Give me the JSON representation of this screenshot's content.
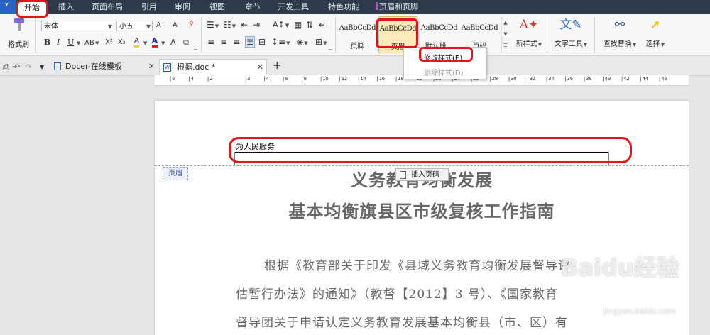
{
  "menubar": {
    "app_menu_arrow": "▾",
    "tabs": [
      {
        "label": "开始",
        "active": true
      },
      {
        "label": "插入"
      },
      {
        "label": "页面布局"
      },
      {
        "label": "引用"
      },
      {
        "label": "审阅"
      },
      {
        "label": "视图"
      },
      {
        "label": "章节"
      },
      {
        "label": "开发工具"
      },
      {
        "label": "特色功能"
      },
      {
        "label": "页眉和页脚",
        "contextual": true,
        "accent": "#b04ad0"
      }
    ]
  },
  "ribbon": {
    "format_painter_label": "格式刷",
    "font_name": "宋体",
    "font_size": "小五",
    "grow_font": "A⁺",
    "shrink_font": "A⁻",
    "bold": "B",
    "italic": "I",
    "underline": "U",
    "strike": "AB",
    "superscript": "X²",
    "subscript": "X₂",
    "font_color": "A",
    "highlight": "A",
    "styles": [
      {
        "preview": "AaBbCcDd",
        "name": "页脚"
      },
      {
        "preview": "AaBbCcDd",
        "name": "页眉",
        "selected": true
      },
      {
        "preview": "AaBbCcDd",
        "name": "默认段..."
      },
      {
        "preview": "AaBbCcDd",
        "name": "页码"
      }
    ],
    "new_style_label": "新样式",
    "text_tools_label": "文字工具",
    "find_replace_label": "查找替换",
    "select_label": "选择"
  },
  "style_menu": {
    "modify": "修改样式(E)",
    "delete": "删除样式(D)"
  },
  "doctabs": {
    "tabs": [
      {
        "label": "Docer-在线模板",
        "close": "✕"
      },
      {
        "label": "根据.doc *",
        "close": "✕",
        "active": true
      }
    ],
    "add": "+"
  },
  "ruler": {
    "numbers": [
      "6",
      "4",
      "2",
      "",
      "2",
      "4",
      "6",
      "8",
      "10",
      "12",
      "14",
      "16",
      "18",
      "20",
      "22",
      "24",
      "26",
      "28",
      "30",
      "32",
      "34",
      "36",
      "38",
      "40",
      "42",
      "44",
      "46"
    ]
  },
  "document": {
    "header_text": "为人民服务",
    "header_tag": "页眉",
    "insert_page_number": "插入页码",
    "title_line1": "义务教育均衡发展",
    "title_line2": "基本均衡旗县区市级复核工作指南",
    "para_line1": "根据《教育部关于印发《县域义务教育均衡发展督导评",
    "para_line2": "估暂行办法》的通知》（教督【2012】3 号）、《国家教育",
    "para_line3": "督导团关于申请认定义务教育发展基本均衡县（市、区）有"
  },
  "watermark": {
    "text": "Baidu经验",
    "url": "jingyan.baidu.com"
  },
  "colors": {
    "menubar_bg": "#2d3a4c",
    "annotation_red": "#e2151d",
    "selected_style_bg": "#fde9b9"
  }
}
